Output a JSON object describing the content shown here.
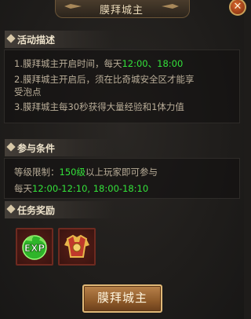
{
  "window": {
    "title": "膜拜城主",
    "close_symbol": "✕"
  },
  "description": {
    "heading": "活动描述",
    "line1_prefix": "1.膜拜城主开启时间，每天",
    "line1_times": "12:00、18:00",
    "line2a": "2.膜拜城主开启后，须在比奇城安全区才能享",
    "line2b": "受泡点",
    "line3": "3.膜拜城主每30秒获得大量经验和1体力值"
  },
  "conditions": {
    "heading": "参与条件",
    "level_prefix": "等级限制：",
    "level_value": "150级",
    "level_suffix": "以上玩家即可参与",
    "time_prefix": "每天",
    "time_value": "12:00-12:10, 18:00-18:10"
  },
  "rewards": {
    "heading": "任务奖励",
    "items": [
      {
        "icon": "exp-orb-icon",
        "label": "EXP"
      },
      {
        "icon": "armor-chest-icon"
      }
    ]
  },
  "action": {
    "label": "膜拜城主"
  },
  "colors": {
    "highlight": "#33e23a",
    "text": "#b9ad98",
    "button": "#8e5a2a"
  }
}
